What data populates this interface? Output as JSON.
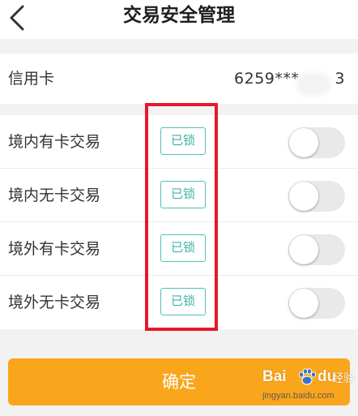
{
  "header": {
    "title": "交易安全管理"
  },
  "card": {
    "label": "信用卡",
    "number": "6259***",
    "number_tail": "3"
  },
  "transactions": [
    {
      "label": "境内有卡交易",
      "badge": "已锁",
      "enabled": false
    },
    {
      "label": "境内无卡交易",
      "badge": "已锁",
      "enabled": false
    },
    {
      "label": "境外有卡交易",
      "badge": "已锁",
      "enabled": false
    },
    {
      "label": "境外无卡交易",
      "badge": "已锁",
      "enabled": false
    }
  ],
  "footer": {
    "confirm_label": "确定"
  },
  "watermark": {
    "brand_left": "Bai",
    "brand_right": "du",
    "product": "经验",
    "url": "jingyan.baidu.com"
  },
  "colors": {
    "accent": "#f9a61c",
    "badge": "#4fc1b7",
    "highlight": "#e7182c",
    "toggle_off": "#e9e9e9"
  },
  "icons": {
    "back": "chevron-left-icon",
    "watermark": "baidu-paw-icon"
  }
}
